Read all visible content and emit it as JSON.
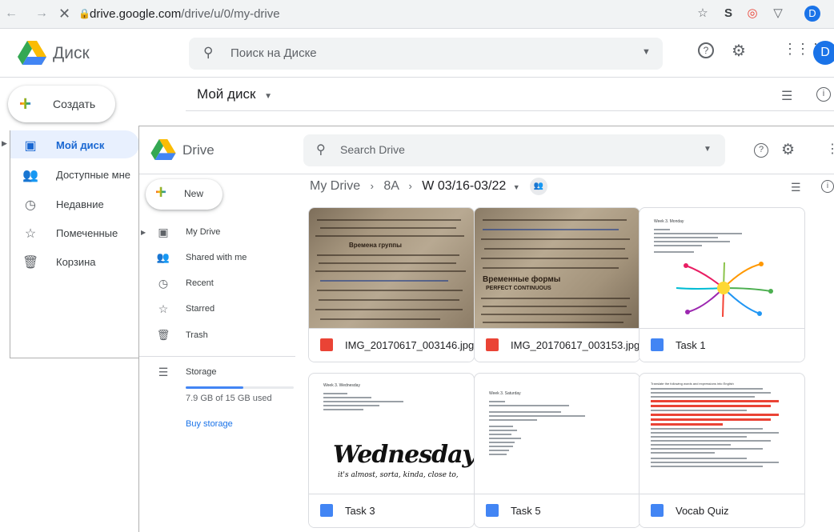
{
  "browser": {
    "url_host": "drive.google.com",
    "url_path": "/drive/u/0/my-drive",
    "avatar_letter": "D"
  },
  "ru_app": {
    "app_name": "Диск",
    "search_placeholder": "Поиск на Диске",
    "create_label": "Создать",
    "page_title": "Мой диск",
    "avatar_letter": "D",
    "nav": [
      {
        "label": "Мой диск",
        "icon": "drive-icon",
        "active": true
      },
      {
        "label": "Доступные мне",
        "icon": "shared-icon"
      },
      {
        "label": "Недавние",
        "icon": "clock-icon"
      },
      {
        "label": "Помеченные",
        "icon": "star-icon"
      },
      {
        "label": "Корзина",
        "icon": "trash-icon"
      }
    ]
  },
  "en_app": {
    "app_name": "Drive",
    "search_placeholder": "Search Drive",
    "new_label": "New",
    "breadcrumb": [
      "My Drive",
      "8A",
      "W 03/16-03/22"
    ],
    "nav": [
      {
        "label": "My Drive",
        "icon": "drive-icon"
      },
      {
        "label": "Shared with me",
        "icon": "shared-icon"
      },
      {
        "label": "Recent",
        "icon": "clock-icon"
      },
      {
        "label": "Starred",
        "icon": "star-icon"
      },
      {
        "label": "Trash",
        "icon": "trash-icon"
      }
    ],
    "storage": {
      "label": "Storage",
      "usage_text": "7.9 GB of 15 GB used",
      "used_fraction": 0.53,
      "buy_label": "Buy storage"
    },
    "files": [
      {
        "name": "IMG_20170617_003146.jpg",
        "type": "image",
        "icon_color": "#ea4335"
      },
      {
        "name": "IMG_20170617_003153.jpg",
        "type": "image",
        "icon_color": "#ea4335"
      },
      {
        "name": "Task 1",
        "type": "doc",
        "icon_color": "#4285f4"
      },
      {
        "name": "Task 3",
        "type": "doc",
        "icon_color": "#4285f4"
      },
      {
        "name": "Task 5",
        "type": "doc",
        "icon_color": "#4285f4"
      },
      {
        "name": "Vocab Quiz",
        "type": "doc",
        "icon_color": "#4285f4"
      }
    ],
    "thumb_texts": {
      "photo1_heading": "Времена группы",
      "photo2_heading": "Временные формы",
      "photo2_sub": "PERFECT CONTINUOUS",
      "task1_title": "Week 3. Monday",
      "task3_title": "Week 3. Wednesday",
      "task3_big": "Wednesday",
      "task3_small": "it's almost, sorta, kinda, close to,",
      "task5_title": "Week 3. Saturday",
      "vocab_title": "Translate the following words and expressions into English"
    }
  },
  "colors": {
    "accent_blue": "#1a73e8",
    "active_nav_bg": "#e8f0fe",
    "google_yellow": "#fbbc04",
    "google_green": "#34a853",
    "google_red": "#ea4335"
  }
}
